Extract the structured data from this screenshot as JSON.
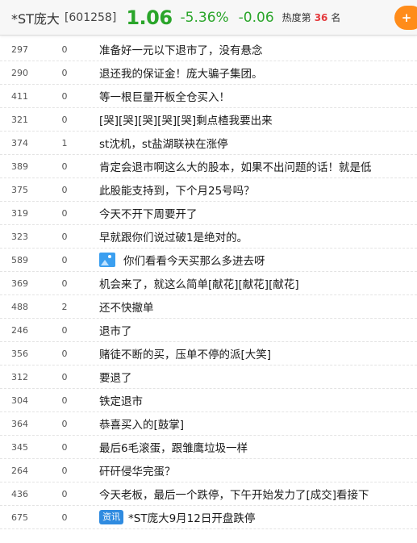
{
  "header": {
    "name": "*ST庞大",
    "code": "[601258]",
    "price": "1.06",
    "change_pct": "-5.36%",
    "change": "-0.06",
    "heat_label": "热度第",
    "heat_rank": "36",
    "heat_unit": "名",
    "fav_icon": "plus-icon",
    "colors": {
      "down": "#2aa52a",
      "rank": "#e4393c",
      "accent": "#ff8c1a"
    }
  },
  "posts": [
    {
      "reads": "297",
      "replies": "0",
      "title": "准备好一元以下退市了，没有悬念"
    },
    {
      "reads": "290",
      "replies": "0",
      "title": "退还我的保证金！庞大骗子集团。"
    },
    {
      "reads": "411",
      "replies": "0",
      "title": "等一根巨量开板全仓买入！"
    },
    {
      "reads": "321",
      "replies": "0",
      "title": "[哭][哭][哭][哭][哭]剩点楂我要出来"
    },
    {
      "reads": "374",
      "replies": "1",
      "title": "st沈机，st盐湖联袂在涨停"
    },
    {
      "reads": "389",
      "replies": "0",
      "title": "肯定会退市啊这么大的股本，如果不出问题的话！就是低"
    },
    {
      "reads": "375",
      "replies": "0",
      "title": "此股能支持到，下个月25号吗？"
    },
    {
      "reads": "319",
      "replies": "0",
      "title": "今天不开下周要开了"
    },
    {
      "reads": "323",
      "replies": "0",
      "title": "早就跟你们说过破1是绝对的。"
    },
    {
      "reads": "589",
      "replies": "0",
      "title": "你们看看今天买那么多进去呀",
      "icon": "image-icon"
    },
    {
      "reads": "369",
      "replies": "0",
      "title": "机会来了，就这么简单[献花][献花][献花]"
    },
    {
      "reads": "488",
      "replies": "2",
      "title": "还不快撤单"
    },
    {
      "reads": "246",
      "replies": "0",
      "title": "退市了"
    },
    {
      "reads": "356",
      "replies": "0",
      "title": "赌徒不断的买，压单不停的派[大笑]"
    },
    {
      "reads": "312",
      "replies": "0",
      "title": "要退了"
    },
    {
      "reads": "304",
      "replies": "0",
      "title": "铁定退市"
    },
    {
      "reads": "364",
      "replies": "0",
      "title": "恭喜买入的[鼓掌]"
    },
    {
      "reads": "345",
      "replies": "0",
      "title": "最后6毛滚蛋，跟雏鹰垃圾一样"
    },
    {
      "reads": "264",
      "replies": "0",
      "title": "矸矸侵华完蛋？"
    },
    {
      "reads": "436",
      "replies": "0",
      "title": "今天老板，最后一个跌停，下午开始发力了[成交]看接下"
    },
    {
      "reads": "675",
      "replies": "0",
      "title": "*ST庞大9月12日开盘跌停",
      "badge": "资讯"
    }
  ]
}
